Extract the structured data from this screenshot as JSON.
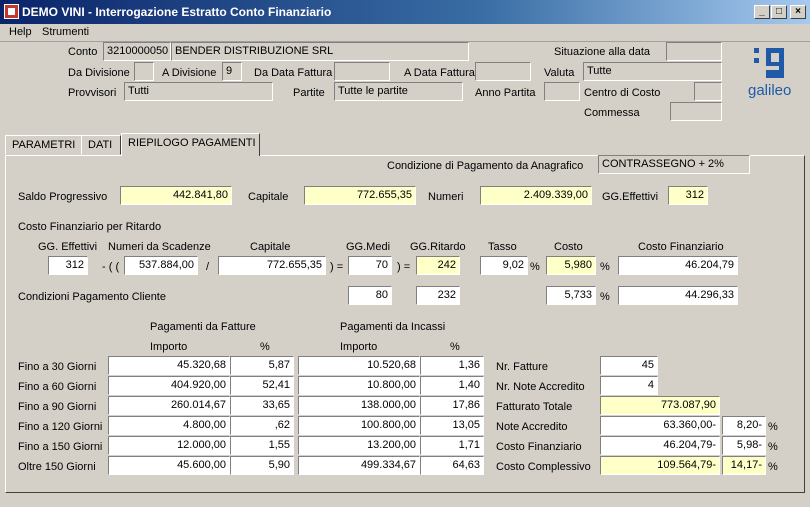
{
  "window": {
    "title": "DEMO VINI - Interrogazione Estratto Conto Finanziario"
  },
  "menu": {
    "help": "Help",
    "strumenti": "Strumenti"
  },
  "header": {
    "conto_label": "Conto",
    "conto_code": "3210000050",
    "conto_name": "BENDER DISTRIBUZIONE SRL",
    "situazione_label": "Situazione alla data",
    "situazione_value": "",
    "da_divisione_label": "Da Divisione",
    "da_divisione_value": "",
    "a_divisione_label": "A Divisione",
    "a_divisione_value": "9",
    "da_data_fattura_label": "Da Data Fattura",
    "da_data_fattura_value": "",
    "a_data_fattura_label": "A Data Fattura",
    "a_data_fattura_value": "",
    "valuta_label": "Valuta",
    "valuta_value": "Tutte",
    "provvisori_label": "Provvisori",
    "provvisori_value": "Tutti",
    "partite_label": "Partite",
    "partite_value": "Tutte le partite",
    "anno_partita_label": "Anno Partita",
    "anno_partita_value": "",
    "centro_di_costo_label": "Centro di Costo",
    "centro_di_costo_value": "",
    "commessa_label": "Commessa",
    "commessa_value": "",
    "logo_text": "galileo"
  },
  "tabs": [
    "PARAMETRI",
    "DATI",
    "RIEPILOGO PAGAMENTI"
  ],
  "panel": {
    "condizione_label": "Condizione di Pagamento da Anagrafico",
    "condizione_value": "CONTRASSEGNO + 2%",
    "saldo_label": "Saldo Progressivo",
    "saldo_value": "442.841,80",
    "capitale_label": "Capitale",
    "capitale_value": "772.655,35",
    "numeri_label": "Numeri",
    "numeri_value": "2.409.339,00",
    "ggeff_label": "GG.Effettivi",
    "ggeff_value": "312",
    "costo_ritardo_title": "Costo Finanziario per Ritardo",
    "col_gg_effettivi": "GG. Effettivi",
    "col_numeri_scadenze": "Numeri da Scadenze",
    "col_capitale": "Capitale",
    "col_gg_medi": "GG.Medi",
    "col_gg_ritardo": "GG.Ritardo",
    "col_tasso": "Tasso",
    "col_costo": "Costo",
    "col_costo_fin": "Costo Finanziario",
    "op_minus": "- ( (",
    "op_div": "/",
    "op_eq1": ") =",
    "op_eq2": ") =",
    "pct1": "%",
    "pct2": "%",
    "pct3": "%",
    "row1": {
      "gg_effettivi": "312",
      "numeri": "537.884,00",
      "capitale": "772.655,35",
      "gg_medi": "70",
      "gg_ritardo": "242",
      "tasso": "9,02",
      "costo": "5,980",
      "costo_fin": "46.204,79"
    },
    "condizioni_cliente_label": "Condizioni Pagamento Cliente",
    "row2": {
      "gg_medi": "80",
      "gg_ritardo": "232",
      "costo": "5,733",
      "costo_fin": "44.296,33"
    },
    "pag_fatture_title": "Pagamenti da Fatture",
    "pag_incassi_title": "Pagamenti da Incassi",
    "importo_label_1": "Importo",
    "pct_label_1": "%",
    "importo_label_2": "Importo",
    "pct_label_2": "%",
    "aging": [
      {
        "label": "Fino a   30 Giorni",
        "fatt_imp": "45.320,68",
        "fatt_pct": "5,87",
        "inc_imp": "10.520,68",
        "inc_pct": "1,36"
      },
      {
        "label": "Fino a   60 Giorni",
        "fatt_imp": "404.920,00",
        "fatt_pct": "52,41",
        "inc_imp": "10.800,00",
        "inc_pct": "1,40"
      },
      {
        "label": "Fino a   90 Giorni",
        "fatt_imp": "260.014,67",
        "fatt_pct": "33,65",
        "inc_imp": "138.000,00",
        "inc_pct": "17,86"
      },
      {
        "label": "Fino a 120 Giorni",
        "fatt_imp": "4.800,00",
        "fatt_pct": ",62",
        "inc_imp": "100.800,00",
        "inc_pct": "13,05"
      },
      {
        "label": "Fino a 150 Giorni",
        "fatt_imp": "12.000,00",
        "fatt_pct": "1,55",
        "inc_imp": "13.200,00",
        "inc_pct": "1,71"
      },
      {
        "label": "Oltre   150 Giorni",
        "fatt_imp": "45.600,00",
        "fatt_pct": "5,90",
        "inc_imp": "499.334,67",
        "inc_pct": "64,63"
      }
    ],
    "summary": [
      {
        "label": "Nr. Fatture",
        "value": "45",
        "pct": ""
      },
      {
        "label": "Nr. Note Accredito",
        "value": "4",
        "pct": ""
      },
      {
        "label": "Fatturato Totale",
        "value": "773.087,90",
        "pct": ""
      },
      {
        "label": "Note Accredito",
        "value": "63.360,00-",
        "pct": "8,20-",
        "pct_sign": "%"
      },
      {
        "label": "Costo Finanziario",
        "value": "46.204,79-",
        "pct": "5,98-",
        "pct_sign": "%"
      },
      {
        "label": "Costo Complessivo",
        "value": "109.564,79-",
        "pct": "14,17-",
        "pct_sign": "%"
      }
    ]
  }
}
